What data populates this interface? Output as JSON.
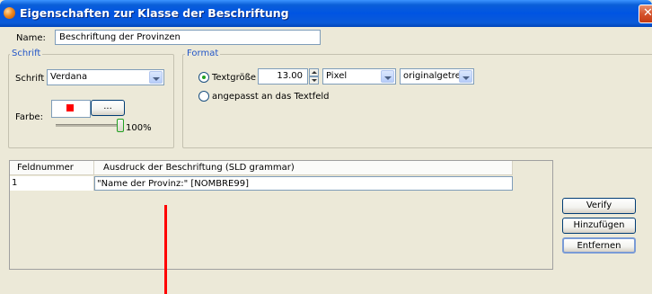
{
  "window": {
    "title": "Eigenschaften zur Klasse der Beschriftung",
    "close_glyph": "✕"
  },
  "name": {
    "label": "Name:",
    "value": "Beschriftung der Provinzen"
  },
  "schrift": {
    "legend": "Schrift",
    "font_label": "Schrift",
    "font_value": "Verdana",
    "color_label": "Farbe:",
    "color_swatch": "#ff0000",
    "color_button": "...",
    "opacity": "100%",
    "opacity_level": 1.0
  },
  "format": {
    "legend": "Format",
    "radio_size_label": "Textgröße",
    "size_value": "13.00",
    "unit_value": "Pixel",
    "scale_value": "originalgetreu",
    "radio_fit_label": "angepasst an das Textfeld"
  },
  "table": {
    "columns": [
      "Feldnummer",
      "Ausdruck der Beschriftung (SLD grammar)"
    ],
    "rows": [
      [
        "1",
        "\"Name der Provinz:\" [NOMBRE99]"
      ]
    ]
  },
  "buttons": {
    "verify": "Verify",
    "add": "Hinzufügen",
    "remove": "Entfernen"
  },
  "colors": {
    "titlebar": "#0054e3",
    "marker_line": "#ff0000",
    "legend_text": "#2356c8"
  }
}
